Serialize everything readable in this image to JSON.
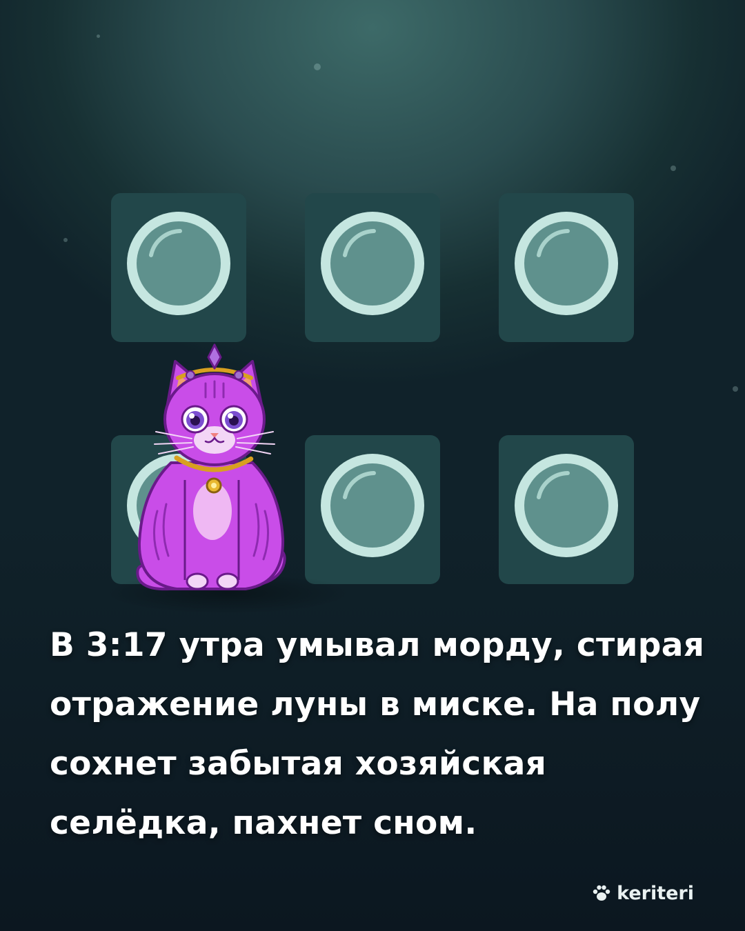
{
  "scene": {
    "background_color": "#173033",
    "tile_color": "#22474a",
    "bubble_ring_color": "#c5e6e0",
    "bubble_fill_color": "#5f918d",
    "tiles": [
      {
        "name": "bubble-tile-1",
        "icon": "bubble-icon"
      },
      {
        "name": "bubble-tile-2",
        "icon": "bubble-icon"
      },
      {
        "name": "bubble-tile-3",
        "icon": "bubble-icon"
      },
      {
        "name": "bubble-tile-4",
        "icon": "bubble-icon"
      },
      {
        "name": "bubble-tile-5",
        "icon": "bubble-icon"
      },
      {
        "name": "bubble-tile-6",
        "icon": "bubble-icon"
      }
    ],
    "character": {
      "icon": "purple-cat-with-tiara-icon",
      "color": "#c94de8"
    }
  },
  "caption": {
    "text": "В 3:17 утра умывал морду, стирая отражение луны в миске. На полу сохнет забытая хозяйская селёдка, пахнет сном."
  },
  "brand": {
    "name": "keriteri",
    "icon": "paw-icon"
  }
}
